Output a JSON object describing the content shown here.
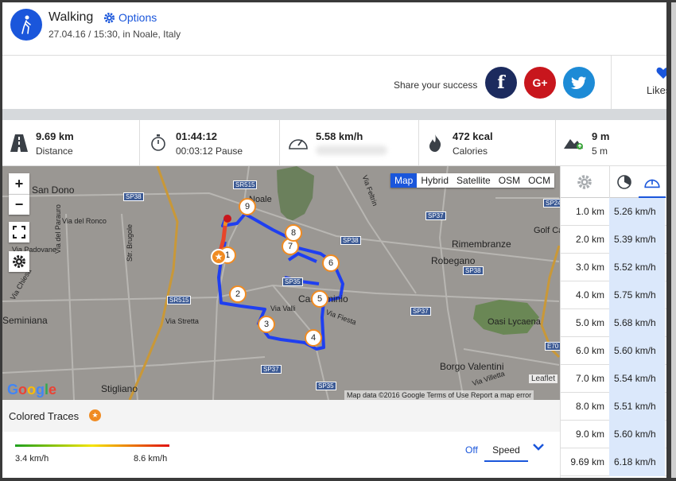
{
  "activity": {
    "title": "Walking",
    "options_label": "Options",
    "subtitle": "27.04.16 / 15:30, in Noale, Italy"
  },
  "share": {
    "text": "Share your success",
    "facebook": "f",
    "google": "G+",
    "likes_label": "Likes"
  },
  "stats": [
    {
      "value": "9.69 km",
      "label": "Distance",
      "icon": "road-icon"
    },
    {
      "value": "01:44:12",
      "label": "00:03:12 Pause",
      "icon": "stopwatch-icon"
    },
    {
      "value": "5.58 km/h",
      "label": "",
      "icon": "speedometer-icon"
    },
    {
      "value": "472 kcal",
      "label": "Calories",
      "icon": "flame-icon"
    },
    {
      "value": "9 m",
      "label": "5 m",
      "icon": "elevation-icon"
    }
  ],
  "map": {
    "types": [
      "Map",
      "Hybrid",
      "Satellite",
      "OSM",
      "OCM"
    ],
    "active_type": "Map",
    "zoom_in": "+",
    "zoom_out": "−",
    "attribution": "Map data ©2016 Google   Terms of Use   Report a map error",
    "leaflet": "Leaflet",
    "google_logo": "Google",
    "places": [
      "San Dono",
      "Via del Ronco",
      "Via Padovane",
      "Via del Parauro",
      "Str. Brugole",
      "Via Chiesa",
      "Seminiana",
      "Via Stretta",
      "Stigliano",
      "Via Valli",
      "Via Fiesta",
      "Castelminio",
      "Rimembranze",
      "Robegano",
      "Golf Ca",
      "Borgo Valentini",
      "Oasi Lycaena",
      "Via Villetta",
      "Via Feltrin",
      "Noale"
    ],
    "roads": [
      "SR515",
      "SP38",
      "SP38",
      "SP35",
      "SR515",
      "SP37",
      "SP37",
      "SP38",
      "SP35",
      "SP37",
      "SP24",
      "E70"
    ],
    "markers": [
      "1",
      "2",
      "3",
      "4",
      "5",
      "6",
      "7",
      "8",
      "9"
    ]
  },
  "traces": {
    "title": "Colored Traces",
    "min": "3.4 km/h",
    "max": "8.6 km/h",
    "off_label": "Off",
    "speed_label": "Speed"
  },
  "splits": [
    {
      "km": "1.0 km",
      "speed": "5.26 km/h"
    },
    {
      "km": "2.0 km",
      "speed": "5.39 km/h"
    },
    {
      "km": "3.0 km",
      "speed": "5.52 km/h"
    },
    {
      "km": "4.0 km",
      "speed": "5.75 km/h"
    },
    {
      "km": "5.0 km",
      "speed": "5.68 km/h"
    },
    {
      "km": "6.0 km",
      "speed": "5.60 km/h"
    },
    {
      "km": "7.0 km",
      "speed": "5.54 km/h"
    },
    {
      "km": "8.0 km",
      "speed": "5.51 km/h"
    },
    {
      "km": "9.0 km",
      "speed": "5.60 km/h"
    },
    {
      "km": "9.69 km",
      "speed": "6.18 km/h"
    }
  ],
  "colors": {
    "accent": "#1a56db",
    "facebook": "#1c2b5e",
    "google": "#c8161d",
    "twitter": "#1d8bd6",
    "route": "#1f3ff0"
  }
}
